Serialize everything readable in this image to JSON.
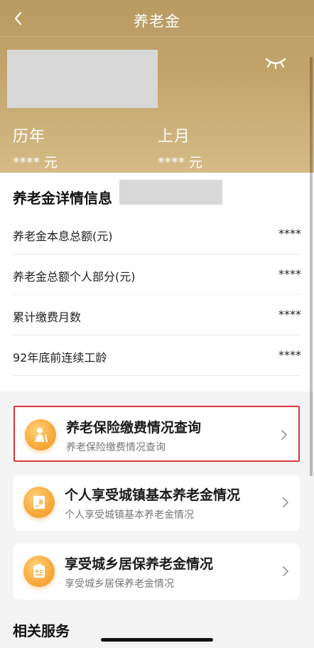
{
  "nav": {
    "title": "养老金"
  },
  "summary": {
    "stats": [
      {
        "label": "历年",
        "value": "**** 元"
      },
      {
        "label": "上月",
        "value": "**** 元"
      }
    ]
  },
  "detail": {
    "title": "养老金详情信息",
    "rows": [
      {
        "label": "养老金本息总额(元)",
        "value": "****"
      },
      {
        "label": "养老金总额个人部分(元)",
        "value": "****"
      },
      {
        "label": "累计缴费月数",
        "value": "****"
      },
      {
        "label": "92年底前连续工龄",
        "value": "****"
      }
    ]
  },
  "cards": [
    {
      "title": "养老保险缴费情况查询",
      "subtitle": "养老保险缴费情况查询"
    },
    {
      "title": "个人享受城镇基本养老金情况",
      "subtitle": "个人享受城镇基本养老金情况"
    },
    {
      "title": "享受城乡居保养老金情况",
      "subtitle": "享受城乡居保养老金情况"
    }
  ],
  "section": {
    "related_title": "相关服务"
  },
  "icons": {
    "back": "chevron-left-icon",
    "eye": "eye-closed-icon",
    "card_chevron": "chevron-right-icon"
  },
  "colors": {
    "header": "#c3a56c",
    "highlight_border": "#d7373f",
    "icon_orange": "#f7a93a"
  }
}
